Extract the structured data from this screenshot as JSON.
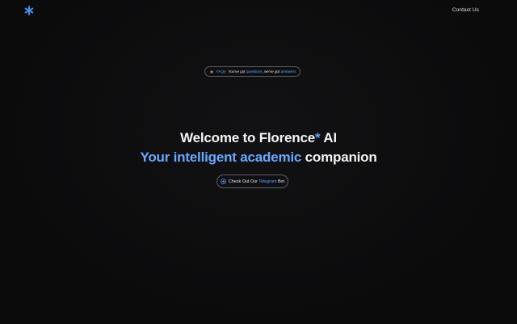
{
  "header": {
    "logo_icon": "asterisk-icon",
    "contact_label": "Contact Us"
  },
  "faq_pill": {
    "icon": "sparkle-icon",
    "faq_label": "FAQs",
    "text_1": "You've got",
    "highlight_1": "questions",
    "text_2": ", we've got",
    "highlight_2": "answers!"
  },
  "hero": {
    "line1_prefix": "Welcome to Florence",
    "line1_star": "*",
    "line1_suffix": " AI",
    "line2_highlight": "Your intelligent academic",
    "line2_suffix": " companion"
  },
  "telegram_button": {
    "icon": "arrow-circle-icon",
    "text_1": "Check Out Our ",
    "highlight": "Telegram",
    "text_2": " Bot"
  },
  "colors": {
    "background": "#0c0c0d",
    "accent": "#5ea2ff",
    "text": "#f2f2f2",
    "border": "#5a5a5f"
  }
}
